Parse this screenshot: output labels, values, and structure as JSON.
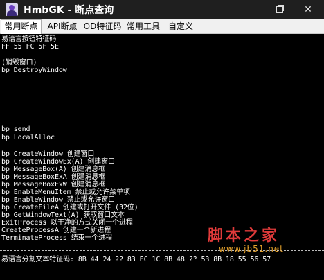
{
  "window": {
    "title": "HmbGK - 断点查询",
    "minimize_icon": "minimize-icon",
    "maximize_icon": "restore-icon",
    "close_icon": "close-icon"
  },
  "tabs": [
    {
      "label": "常用断点",
      "active": true
    },
    {
      "label": "API断点",
      "active": false
    },
    {
      "label": "OD特征码",
      "active": false
    },
    {
      "label": "常用工具",
      "active": false
    },
    {
      "label": "自定义",
      "active": false
    }
  ],
  "content": {
    "lines": [
      "易语言按钮特征码",
      "FF 55 FC 5F 5E",
      "",
      "(销毁窗口)",
      "bp DestroyWindow",
      "bp send",
      "bp LocalAlloc",
      "bp CreateWindow 创建窗口",
      "bp CreateWindowEx(A) 创建窗口",
      "bp MessageBox(A) 创建消息框",
      "bp MessageBoxExA 创建消息框",
      "bp MessageBoxExW 创建消息框",
      "bp EnableMenuItem 禁止或允许菜单项",
      "bp EnableWindow 禁止或允许窗口",
      "bp CreateFileA 创建或打开文件 (32位)",
      "bp GetWindowText(A) 获取窗口文本",
      "ExitProcess 以干净的方式关闭一个进程",
      "CreateProcessA 创建一个新进程",
      "TerminateProcess 结束一个进程",
      "易语言分割文本特征码: 8B 44 24 ?? 83 EC 1C 8B 48 ?? 53 8B 18 55 56 57"
    ],
    "separator": "------------------------------------------------------------------------------------------------"
  },
  "watermark": {
    "main": "脚本之家",
    "sub": "www.jb51.net"
  },
  "colors": {
    "titlebar": "#1f1f1f",
    "background": "#000000",
    "text": "#ffffff",
    "watermark_red": "#e03a3a",
    "watermark_orange": "#e4a12b"
  }
}
